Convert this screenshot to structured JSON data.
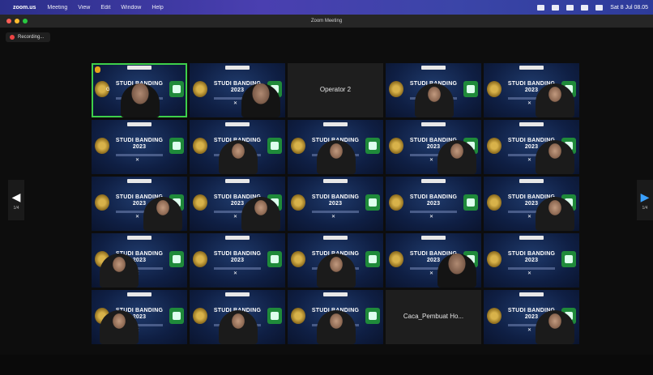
{
  "menubar": {
    "app": "zoom.us",
    "items": [
      "Meeting",
      "View",
      "Edit",
      "Window",
      "Help"
    ],
    "clock": "Sat 8 Jul 08.05"
  },
  "window": {
    "title": "Zoom Meeting"
  },
  "recording": {
    "label": "Recording..."
  },
  "pager": {
    "left_label": "1/4",
    "right_label": "1/4"
  },
  "grid": {
    "background_headline": "STUDI BANDING 2023",
    "tiles": [
      {
        "type": "video",
        "active": true,
        "mic": true,
        "person": "male",
        "caption": "G"
      },
      {
        "type": "video",
        "person": "male-right"
      },
      {
        "type": "name",
        "name": "Operator 2"
      },
      {
        "type": "video",
        "person": "hijab"
      },
      {
        "type": "video",
        "person": "hijab-right"
      },
      {
        "type": "video",
        "person": "none"
      },
      {
        "type": "video",
        "person": "hijab"
      },
      {
        "type": "video",
        "person": "hijab"
      },
      {
        "type": "video",
        "person": "hijab-right"
      },
      {
        "type": "video",
        "person": "hijab-right"
      },
      {
        "type": "video",
        "person": "hijab-right"
      },
      {
        "type": "video",
        "person": "hijab-right"
      },
      {
        "type": "video",
        "person": "none"
      },
      {
        "type": "video",
        "person": "none"
      },
      {
        "type": "video",
        "person": "hijab-right"
      },
      {
        "type": "video",
        "person": "hijab-left"
      },
      {
        "type": "video",
        "person": "none"
      },
      {
        "type": "video",
        "person": "hijab"
      },
      {
        "type": "video",
        "person": "dark-right"
      },
      {
        "type": "video",
        "person": "none"
      },
      {
        "type": "video",
        "person": "hijab-left"
      },
      {
        "type": "video",
        "person": "hijab"
      },
      {
        "type": "video",
        "person": "hijab"
      },
      {
        "type": "name",
        "name": "Caca_Pembuat Ho..."
      },
      {
        "type": "video",
        "person": "hijab-right"
      }
    ]
  },
  "colors": {
    "active_speaker": "#3ecf4a",
    "menubar": "#3b3fa0"
  }
}
